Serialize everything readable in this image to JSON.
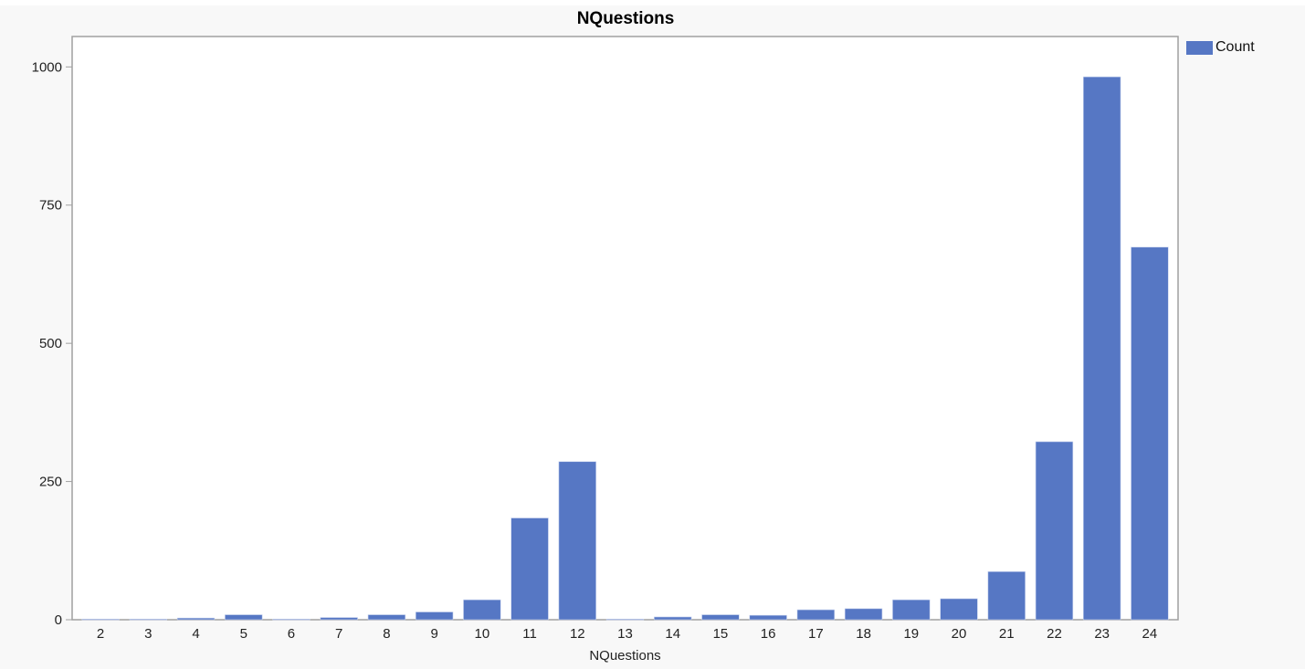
{
  "chart_data": {
    "type": "bar",
    "title": "NQuestions",
    "xlabel": "NQuestions",
    "ylabel": "",
    "categories": [
      "2",
      "3",
      "4",
      "5",
      "6",
      "7",
      "8",
      "9",
      "10",
      "11",
      "12",
      "13",
      "14",
      "15",
      "16",
      "17",
      "18",
      "19",
      "20",
      "21",
      "22",
      "23",
      "24"
    ],
    "series": [
      {
        "name": "Count",
        "color": "#5677c4",
        "values": [
          1,
          1,
          3,
          9,
          1,
          4,
          9,
          14,
          36,
          184,
          286,
          1,
          5,
          9,
          8,
          18,
          20,
          36,
          38,
          87,
          322,
          982,
          674
        ]
      }
    ],
    "ylim": [
      0,
      1055
    ],
    "yticks": [
      0,
      250,
      500,
      750,
      1000
    ],
    "grid": false,
    "legend": {
      "position": "top-right",
      "entries": [
        "Count"
      ]
    }
  }
}
